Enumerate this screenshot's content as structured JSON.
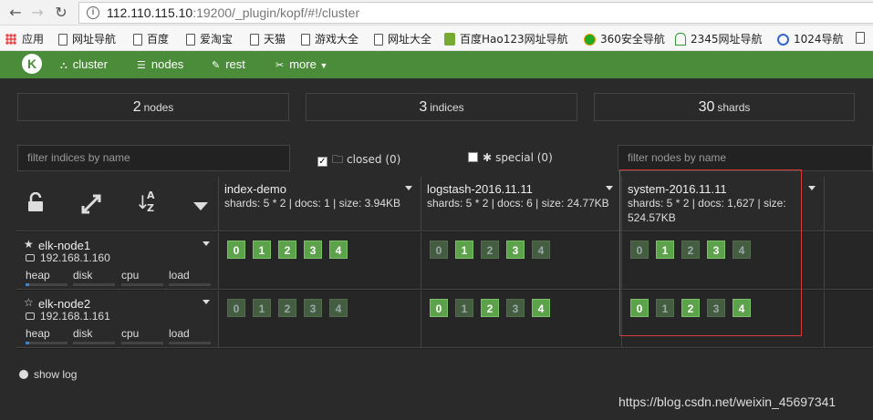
{
  "browser": {
    "url_host": "112.110.115.10",
    "url_rest": ":19200/_plugin/kopf/#!/cluster",
    "bookmarks": [
      "应用",
      "网址导航",
      "百度",
      "爱淘宝",
      "天猫",
      "游戏大全",
      "网址大全",
      "百度Hao123网址导航",
      "360安全导航",
      "2345网址导航",
      "1024导航"
    ]
  },
  "nav": {
    "logo": "K",
    "cluster": "cluster",
    "nodes": "nodes",
    "rest": "rest",
    "more": "more"
  },
  "stats": {
    "nodes_num": "2",
    "nodes_lbl": "nodes",
    "indices_num": "3",
    "indices_lbl": "indices",
    "shards_num": "30",
    "shards_lbl": "shards"
  },
  "filters": {
    "indices_placeholder": "filter indices by name",
    "nodes_placeholder": "filter nodes by name",
    "closed_label": "closed (0)",
    "special_label": "special (0)"
  },
  "indices": [
    {
      "name": "index-demo",
      "meta": "shards: 5 * 2 | docs: 1 | size: 3.94KB"
    },
    {
      "name": "logstash-2016.11.11",
      "meta": "shards: 5 * 2 | docs: 6 | size: 24.77KB"
    },
    {
      "name": "system-2016.11.11",
      "meta": "shards: 5 * 2 | docs: 1,627 | size: 524.57KB"
    }
  ],
  "nodes": [
    {
      "name": "elk-node1",
      "ip": "192.168.1.160",
      "heap": 0.08,
      "disk": 0,
      "cpu": 0,
      "load": 0
    },
    {
      "name": "elk-node2",
      "ip": "192.168.1.161",
      "heap": 0.08,
      "disk": 0,
      "cpu": 0,
      "load": 0
    }
  ],
  "metrics": {
    "heap": "heap",
    "disk": "disk",
    "cpu": "cpu",
    "load": "load"
  },
  "shards": {
    "labels": [
      "0",
      "1",
      "2",
      "3",
      "4"
    ],
    "node1": [
      [
        1,
        1,
        1,
        1,
        1
      ],
      [
        0,
        1,
        0,
        1,
        0
      ],
      [
        0,
        1,
        0,
        1,
        0
      ]
    ],
    "node2": [
      [
        0,
        0,
        0,
        0,
        0
      ],
      [
        1,
        0,
        1,
        0,
        1
      ],
      [
        1,
        0,
        1,
        0,
        1
      ]
    ]
  },
  "footer": {
    "show_log": "show log",
    "watermark": "https://blog.csdn.net/weixin_45697341"
  },
  "colors": {
    "accent": "#4a8c39",
    "shard_primary": "#5ca24a",
    "shard_replica": "#445c40",
    "highlight": "#d43c3c"
  }
}
